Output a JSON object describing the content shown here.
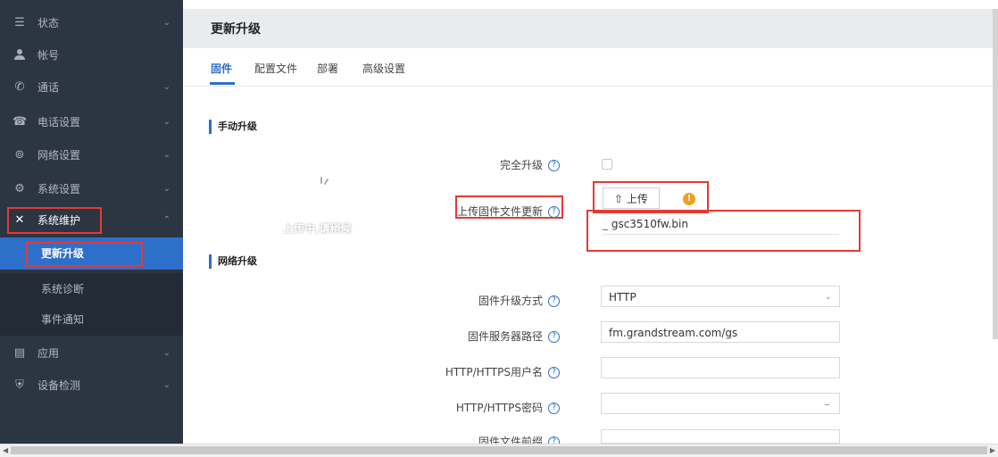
{
  "sidebar": {
    "items": [
      {
        "icon": "list-icon",
        "label": "状态",
        "chevron": "⌄"
      },
      {
        "icon": "user-icon",
        "label": "帐号",
        "chevron": ""
      },
      {
        "icon": "phone-call-icon",
        "label": "通话",
        "chevron": "⌄"
      },
      {
        "icon": "phone-icon",
        "label": "电话设置",
        "chevron": "⌄"
      },
      {
        "icon": "network-icon",
        "label": "网络设置",
        "chevron": "⌄"
      },
      {
        "icon": "system-settings-icon",
        "label": "系统设置",
        "chevron": "⌄"
      },
      {
        "icon": "tools-icon",
        "label": "系统维护",
        "chevron": "⌃"
      }
    ],
    "sub_items": [
      {
        "label": "更新升级"
      },
      {
        "label": "系统诊断"
      },
      {
        "label": "事件通知"
      }
    ],
    "bottom_items": [
      {
        "icon": "document-icon",
        "label": "应用",
        "chevron": "⌄"
      },
      {
        "icon": "shield-icon",
        "label": "设备检测",
        "chevron": "⌄"
      }
    ]
  },
  "header": {
    "title": "更新升级"
  },
  "tabs": [
    {
      "label": "固件"
    },
    {
      "label": "配置文件"
    },
    {
      "label": "部署"
    },
    {
      "label": "高级设置"
    }
  ],
  "manual": {
    "section_title": "手动升级",
    "full_upgrade_label": "完全升级",
    "upload_label": "上传固件文件更新",
    "upload_button": "上传",
    "file_name": "gsc3510fw.bin",
    "overlay_text": "上传中,请稍候",
    "help_glyph": "?",
    "warn_glyph": "!"
  },
  "network": {
    "section_title": "网络升级",
    "rows": [
      {
        "label": "固件升级方式",
        "value": "HTTP"
      },
      {
        "label": "固件服务器路径",
        "value": "fm.grandstream.com/gs"
      },
      {
        "label": "HTTP/HTTPS用户名",
        "value": ""
      },
      {
        "label": "HTTP/HTTPS密码",
        "value": ""
      },
      {
        "label": "固件文件前缀",
        "value": ""
      }
    ]
  },
  "colors": {
    "accent": "#2d6fc9",
    "highlight": "#e53935",
    "sidebar_bg": "#2c3542"
  }
}
